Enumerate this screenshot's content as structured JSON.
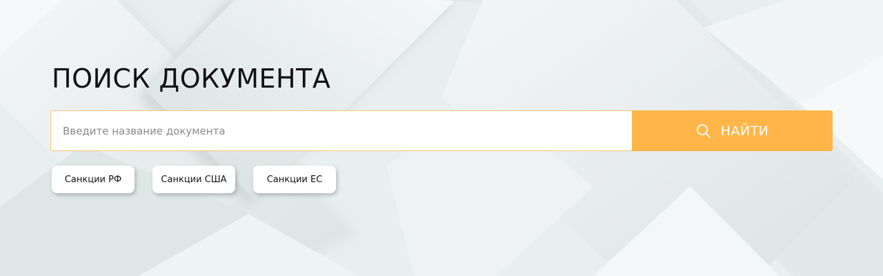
{
  "page": {
    "title": "ПОИСК ДОКУМЕНТА"
  },
  "search": {
    "placeholder": "Введите название документа",
    "value": "",
    "button_label": "НАЙТИ",
    "button_icon": "search-icon"
  },
  "tags": [
    {
      "label": "Санкции РФ"
    },
    {
      "label": "Санкции США"
    },
    {
      "label": "Санкции ЕС"
    }
  ],
  "colors": {
    "accent": "#ffb648",
    "input_border": "#f3c673",
    "background": "#e9eeee",
    "title": "#111111"
  }
}
